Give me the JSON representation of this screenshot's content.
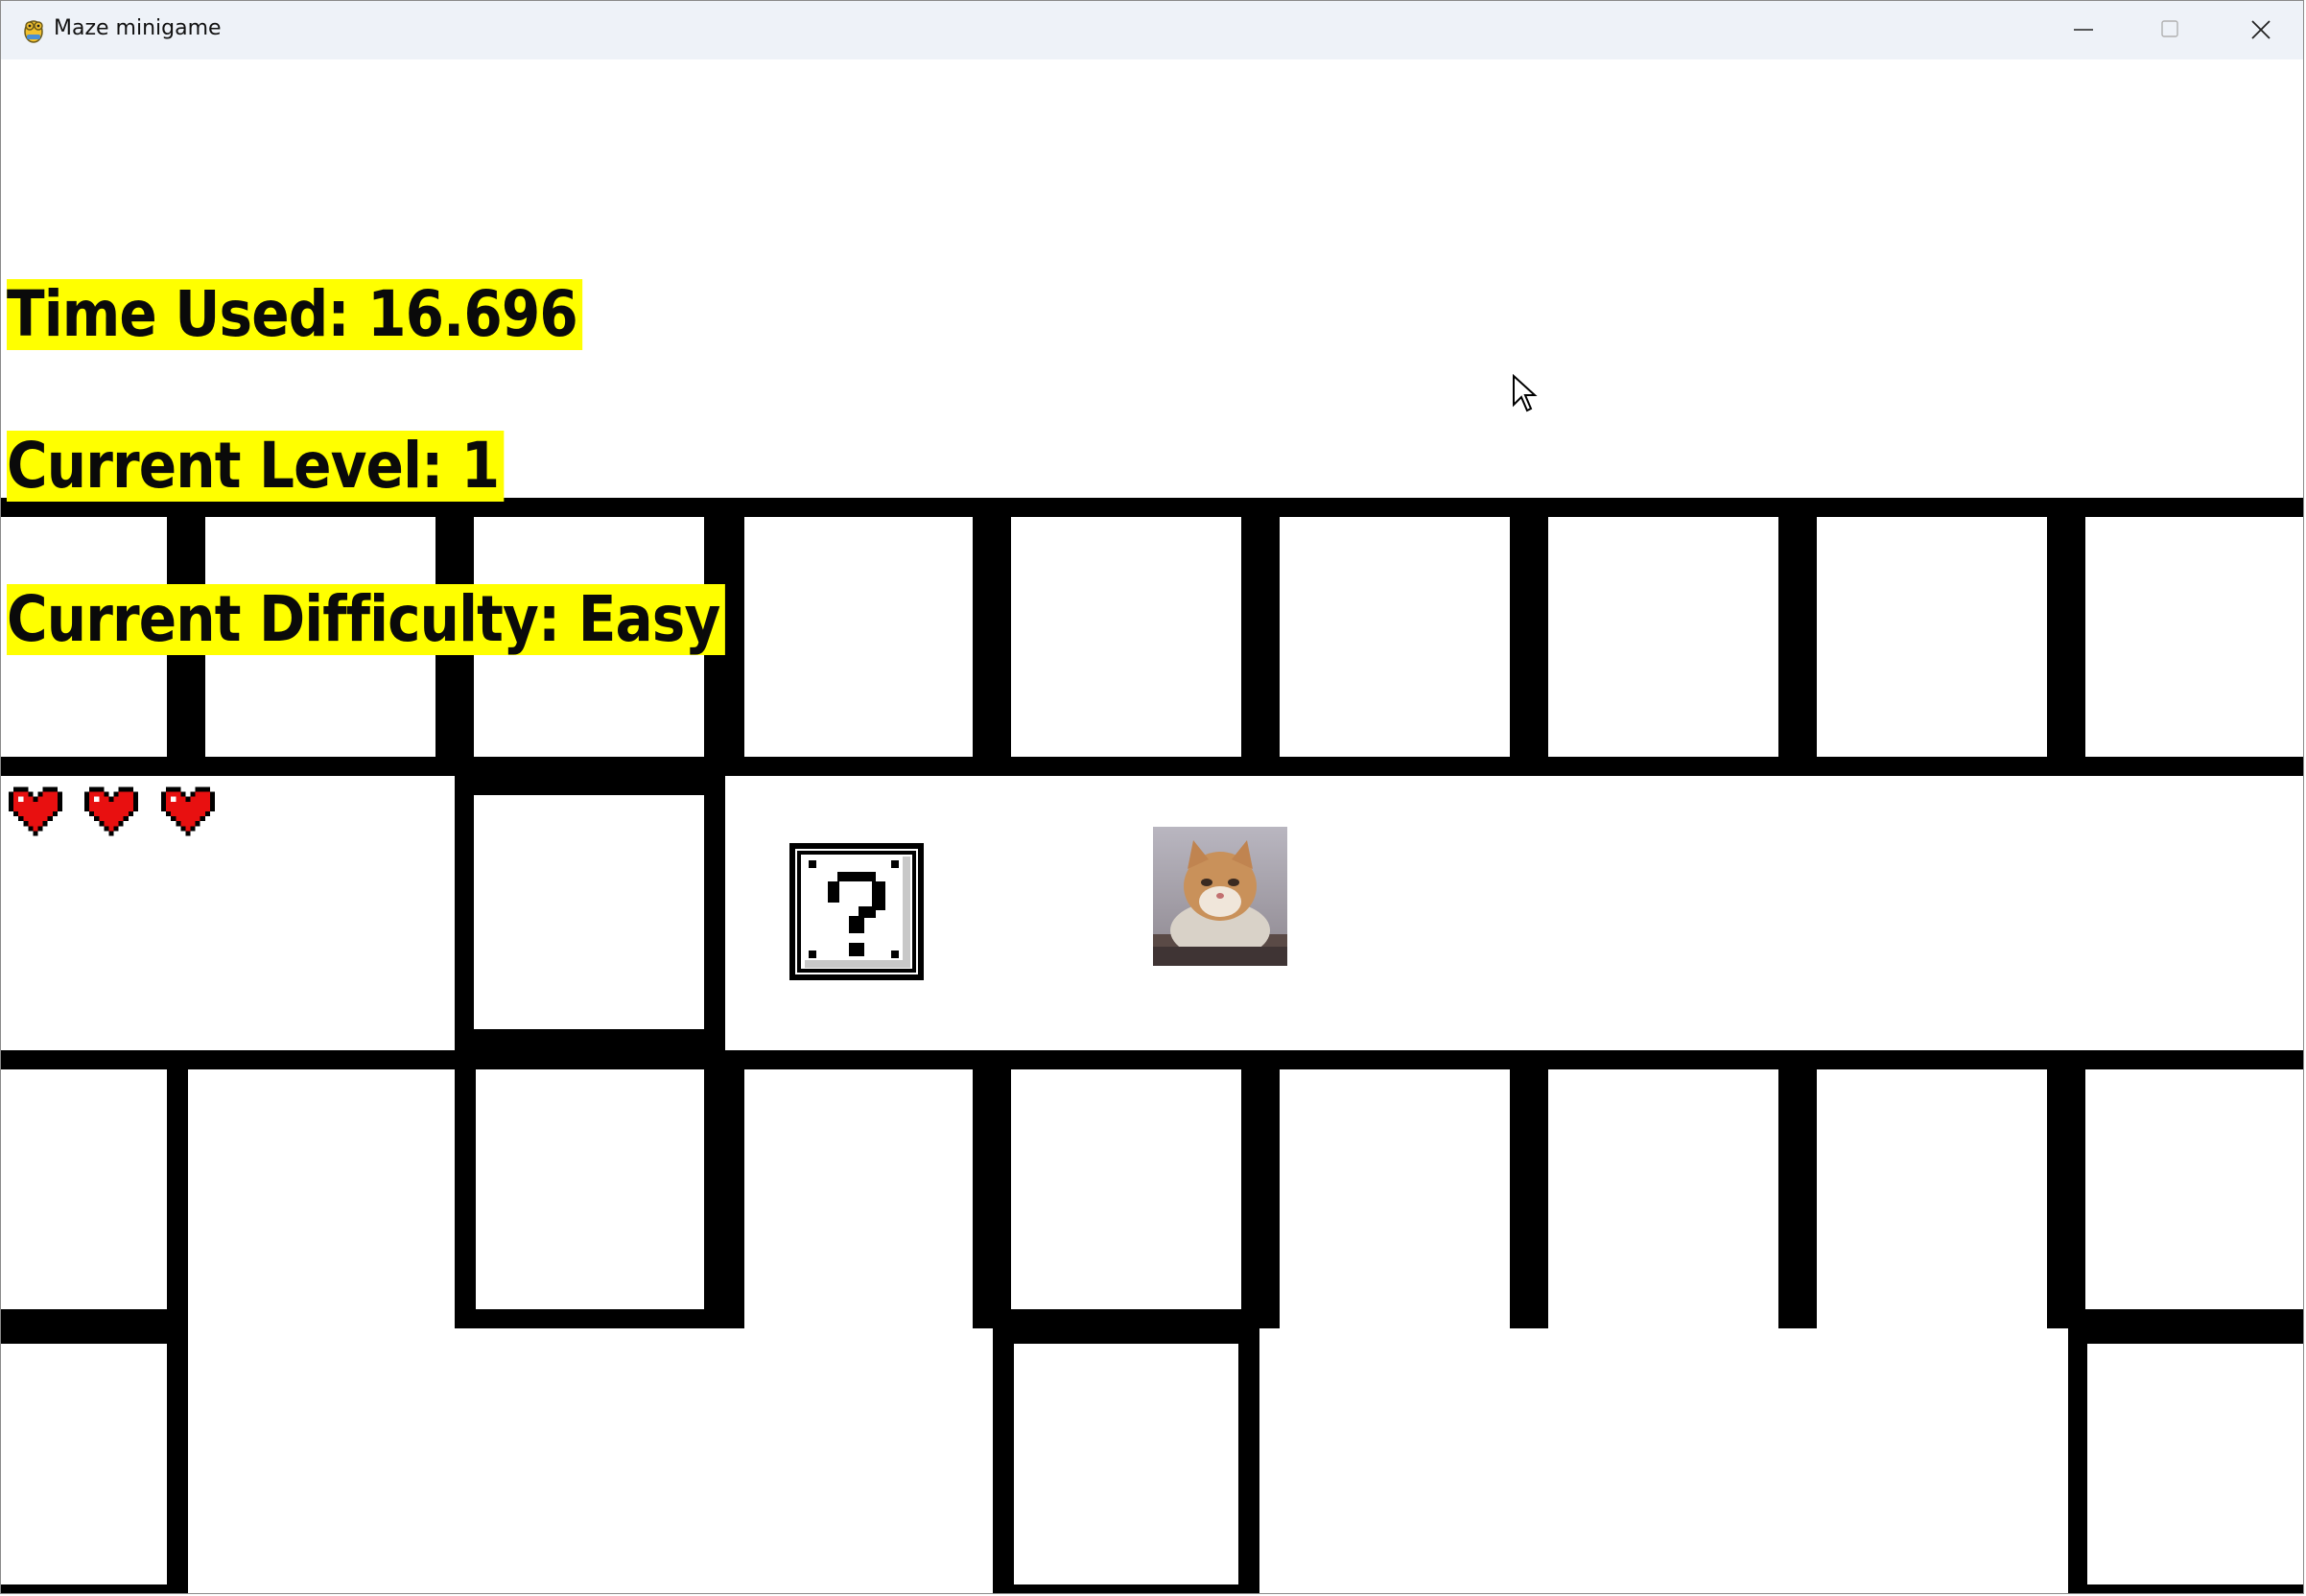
{
  "window": {
    "title": "Maze minigame",
    "controls": [
      "minimize",
      "maximize",
      "close"
    ]
  },
  "hud": {
    "time_used": "Time Used: 16.696",
    "current_level": "Current Level: 1",
    "current_difficulty": "Current Difficulty: Easy"
  },
  "player": {
    "lives": 3,
    "life_icon": "heart-icon",
    "sprite": "cat"
  },
  "items": [
    {
      "type": "mystery-box",
      "icon": "question-mark-block-icon"
    }
  ],
  "colors": {
    "hud_highlight": "#ffff00",
    "wall": "#000000",
    "floor": "#ffffff",
    "heart": "#e81010"
  }
}
